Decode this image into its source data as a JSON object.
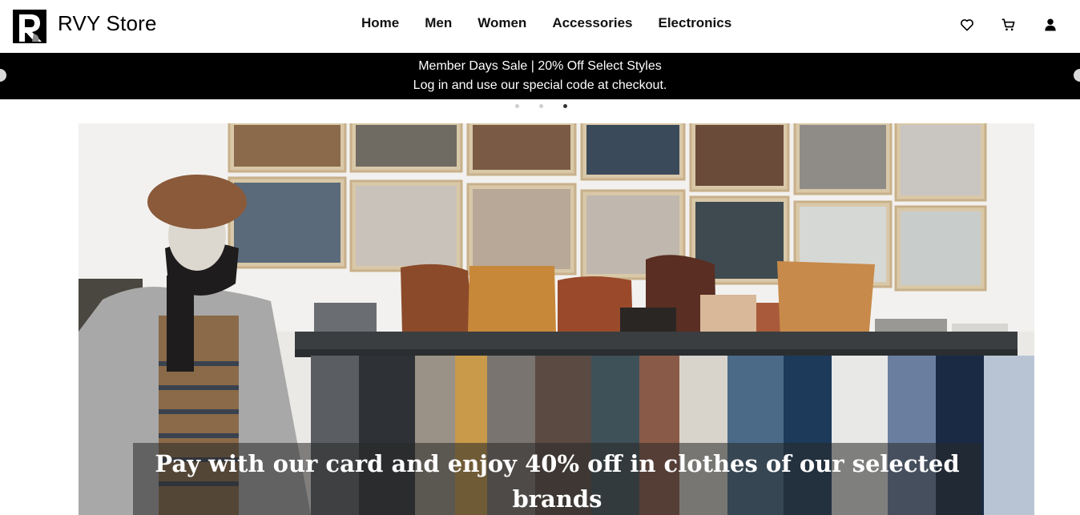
{
  "header": {
    "brand": "RVY Store",
    "nav": [
      "Home",
      "Men",
      "Women",
      "Accessories",
      "Electronics"
    ],
    "icons": [
      "heart-icon",
      "cart-icon",
      "user-icon"
    ]
  },
  "banner": {
    "line1": "Member Days Sale | 20% Off Select Styles",
    "line2": "Log in and use our special code at checkout.",
    "active_slide": 3,
    "slide_count": 3
  },
  "hero": {
    "caption": "Pay with our card and enjoy 40% off in clothes of our selected brands"
  },
  "colors": {
    "banner_bg": "#000000",
    "text": "#111111",
    "caption_bg": "#282828"
  }
}
